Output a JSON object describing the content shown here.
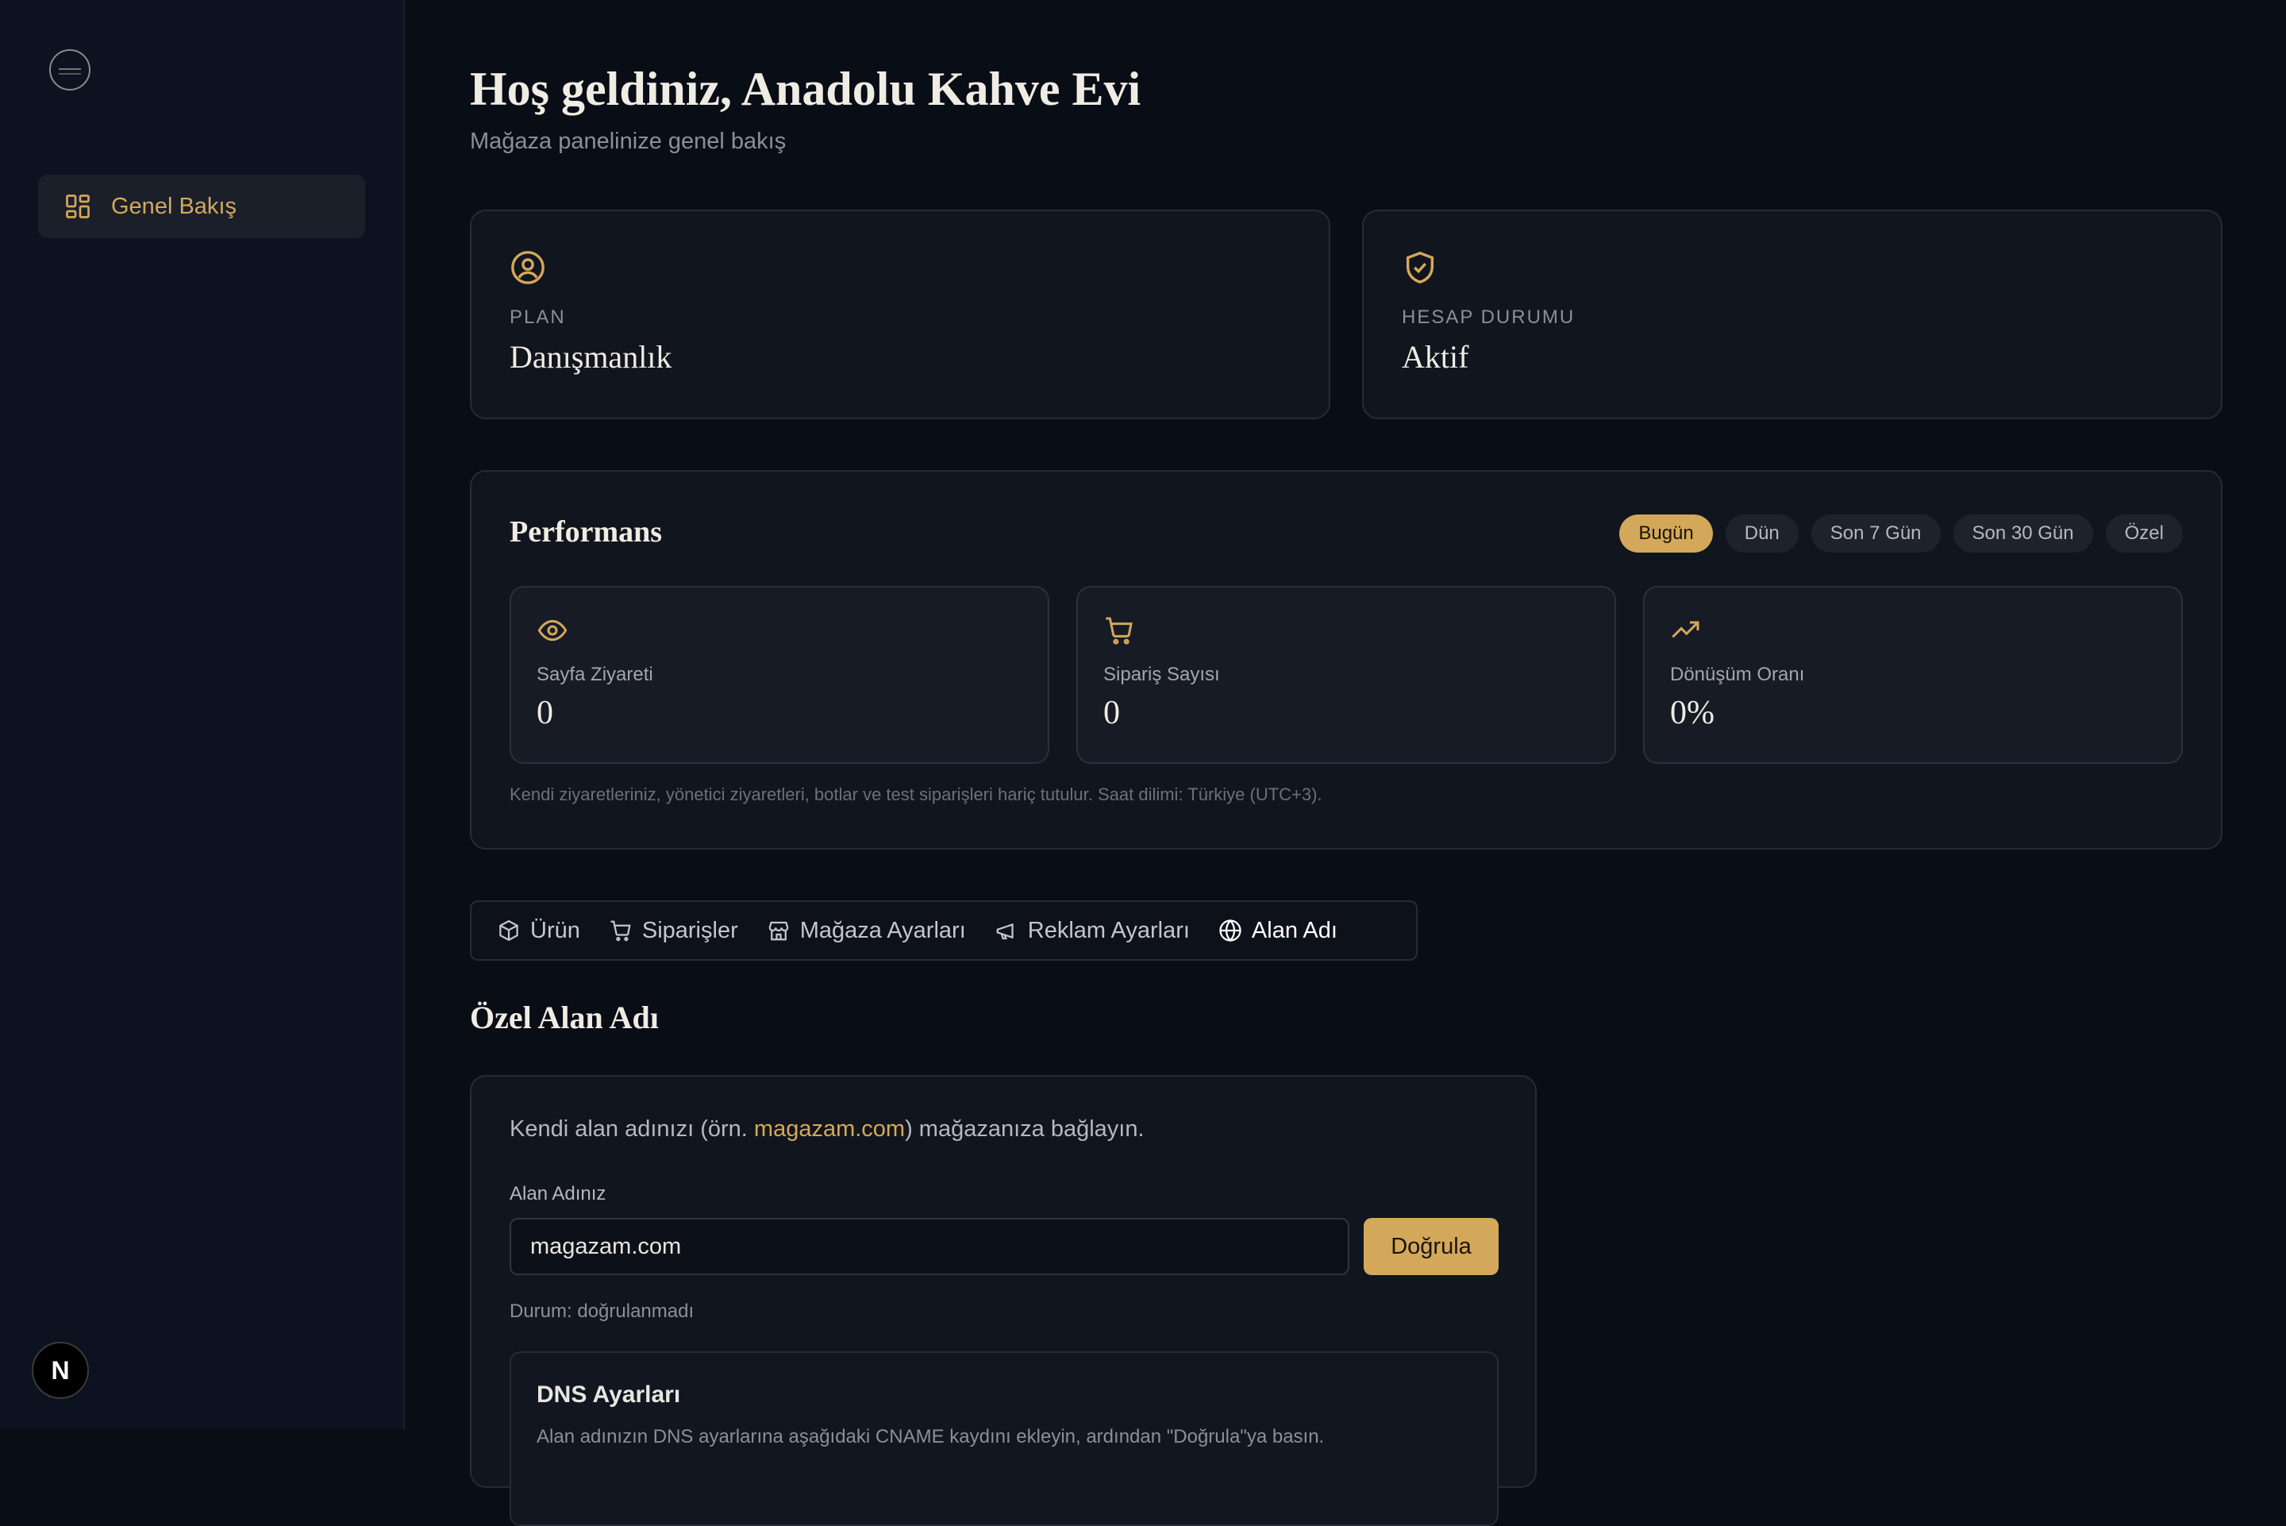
{
  "sidebar": {
    "logo": "logo-emblem",
    "items": [
      {
        "label": "Genel Bakış",
        "icon": "dashboard-icon"
      }
    ]
  },
  "header": {
    "title": "Hoş geldiniz, Anadolu Kahve Evi",
    "subtitle": "Mağaza panelinize genel bakış"
  },
  "cards": {
    "plan": {
      "label": "PLAN",
      "value": "Danışmanlık",
      "icon": "user-circle-icon"
    },
    "status": {
      "label": "HESAP DURUMU",
      "value": "Aktif",
      "icon": "shield-check-icon"
    }
  },
  "performance": {
    "title": "Performans",
    "ranges": [
      "Bugün",
      "Dün",
      "Son 7 Gün",
      "Son 30 Gün",
      "Özel"
    ],
    "active_range": "Bugün",
    "metrics": [
      {
        "label": "Sayfa Ziyareti",
        "value": "0",
        "icon": "eye-icon"
      },
      {
        "label": "Sipariş Sayısı",
        "value": "0",
        "icon": "cart-icon"
      },
      {
        "label": "Dönüşüm Oranı",
        "value": "0%",
        "icon": "trending-up-icon"
      }
    ],
    "note": "Kendi ziyaretleriniz, yönetici ziyaretleri, botlar ve test siparişleri hariç tutulur. Saat dilimi: Türkiye (UTC+3)."
  },
  "tabs": [
    {
      "label": "Ürün",
      "icon": "package-icon"
    },
    {
      "label": "Siparişler",
      "icon": "cart-icon"
    },
    {
      "label": "Mağaza Ayarları",
      "icon": "store-icon"
    },
    {
      "label": "Reklam Ayarları",
      "icon": "megaphone-icon"
    },
    {
      "label": "Alan Adı",
      "icon": "globe-icon"
    }
  ],
  "active_tab": "Alan Adı",
  "domain": {
    "section_title": "Özel Alan Adı",
    "intro_before": "Kendi alan adınızı (örn. ",
    "intro_example": "magazam.com",
    "intro_after": ") mağazanıza bağlayın.",
    "field_label": "Alan Adınız",
    "input_value": "magazam.com",
    "verify_label": "Doğrula",
    "status": "Durum: doğrulanmadı",
    "dns_title": "DNS Ayarları",
    "dns_desc": "Alan adınızın DNS ayarlarına aşağıdaki CNAME kaydını ekleyin, ardından \"Doğrula\"ya basın."
  },
  "colors": {
    "accent": "#d4a85b",
    "background": "#090d16",
    "card": "#11151e"
  },
  "footer_badge": "N"
}
